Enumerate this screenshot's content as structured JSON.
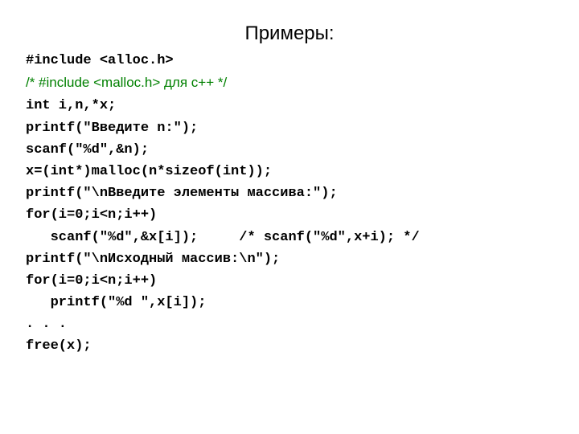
{
  "title": "Примеры:",
  "code": {
    "l1": "#include <alloc.h>",
    "l2": "/* #include <malloc.h> для с++ */",
    "l3": "int i,n,*x;",
    "l4": "printf(\"Введите n:\");",
    "l5": "scanf(\"%d\",&n);",
    "l6": "x=(int*)malloc(n*sizeof(int));",
    "l7": "printf(\"\\nВведите элементы массива:\");",
    "l8": "for(i=0;i<n;i++)",
    "l9": "   scanf(\"%d\",&x[i]);     /* scanf(\"%d\",x+i); */",
    "l10": "printf(\"\\nИсходный массив:\\n\");",
    "l11": "for(i=0;i<n;i++)",
    "l12": "   printf(\"%d \",x[i]);",
    "l13": ". . .",
    "l14": "free(x);"
  }
}
